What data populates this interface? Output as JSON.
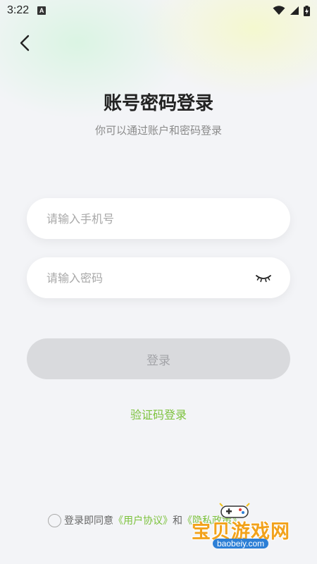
{
  "status_bar": {
    "time": "3:22",
    "notification_icon": "a-icon",
    "icons": [
      "wifi-icon",
      "signal-icon",
      "battery-charging-icon"
    ]
  },
  "header": {
    "back_icon": "chevron-left-icon"
  },
  "main": {
    "title": "账号密码登录",
    "subtitle": "你可以通过账户和密码登录",
    "phone_input": {
      "placeholder": "请输入手机号",
      "value": ""
    },
    "password_input": {
      "placeholder": "请输入密码",
      "value": "",
      "toggle_icon": "eye-closed-icon"
    },
    "login_button": "登录",
    "code_login_link": "验证码登录"
  },
  "agreement": {
    "prefix": "登录即同意",
    "user_agreement": "《用户协议》",
    "and": "和",
    "privacy_policy": "《隐私政策》"
  },
  "watermark": {
    "brand": "宝贝游戏网",
    "url": "baobeiy.com"
  },
  "colors": {
    "accent": "#7cc23c",
    "background": "#f3f4f7",
    "button_disabled_bg": "#d9dadd",
    "button_disabled_text": "#a3a4a8"
  }
}
